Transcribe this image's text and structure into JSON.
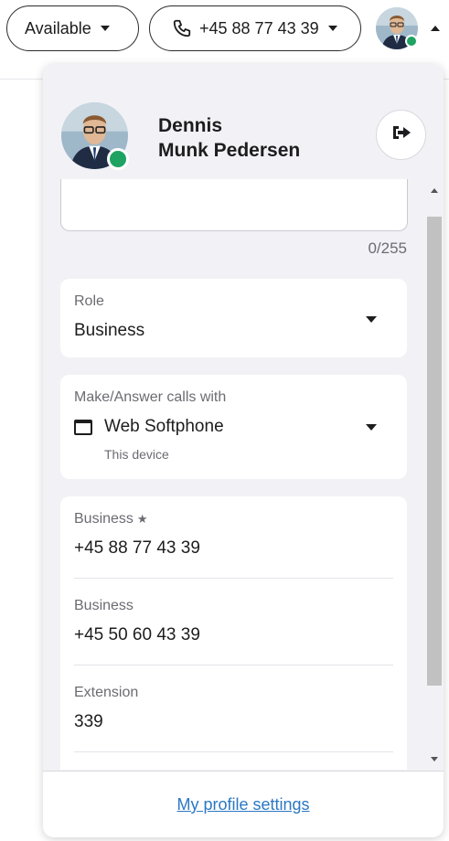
{
  "topbar": {
    "status_label": "Available",
    "phone_number": "+45 88 77 43 39",
    "avatar_status_color": "#1ea362"
  },
  "profile": {
    "first_name": "Dennis",
    "last_name": "Munk Pedersen",
    "status_color": "#1ea362",
    "logout_icon": "logout-icon"
  },
  "status_message": {
    "value": "",
    "char_count": "0/255"
  },
  "role": {
    "label": "Role",
    "value": "Business"
  },
  "calls_with": {
    "label": "Make/Answer calls with",
    "value": "Web Softphone",
    "subtext": "This device",
    "icon": "browser-window-icon"
  },
  "numbers": [
    {
      "label": "Business",
      "starred": "★",
      "value": "+45 88 77 43 39"
    },
    {
      "label": "Business",
      "value": "+45 50 60 43 39"
    },
    {
      "label": "Extension",
      "value": "339"
    }
  ],
  "footer": {
    "link_label": "My profile settings"
  },
  "colors": {
    "accent_link": "#2b78c5",
    "panel_bg": "#f2f2f6",
    "online": "#1ea362"
  }
}
